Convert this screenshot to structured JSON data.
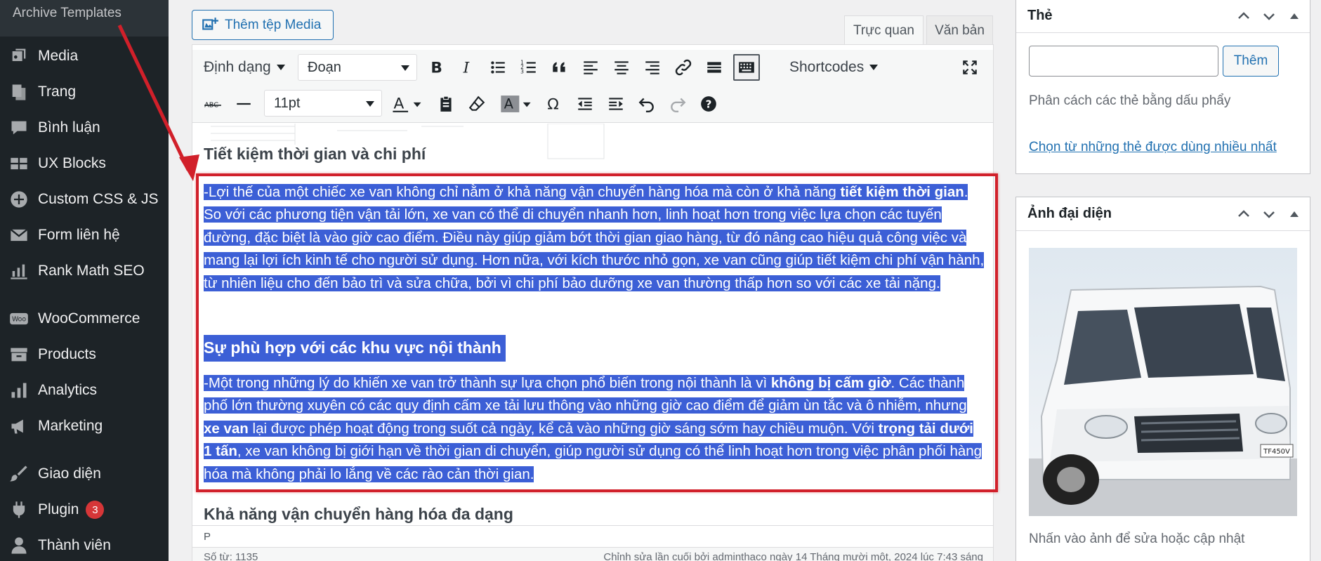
{
  "sidebar": {
    "top_item": "Archive Templates",
    "items": [
      {
        "label": "Media",
        "icon": "media-icon"
      },
      {
        "label": "Trang",
        "icon": "page-icon"
      },
      {
        "label": "Bình luận",
        "icon": "comment-icon"
      },
      {
        "label": "UX Blocks",
        "icon": "blocks-icon"
      },
      {
        "label": "Custom CSS & JS",
        "icon": "plus-circle-icon"
      },
      {
        "label": "Form liên hệ",
        "icon": "mail-icon"
      },
      {
        "label": "Rank Math SEO",
        "icon": "chart-icon"
      },
      {
        "label": "WooCommerce",
        "icon": "woo-icon"
      },
      {
        "label": "Products",
        "icon": "archive-icon"
      },
      {
        "label": "Analytics",
        "icon": "bar-chart-icon"
      },
      {
        "label": "Marketing",
        "icon": "megaphone-icon"
      },
      {
        "label": "Giao diện",
        "icon": "brush-icon"
      },
      {
        "label": "Plugin",
        "icon": "plugin-icon",
        "badge": "3"
      },
      {
        "label": "Thành viên",
        "icon": "user-icon"
      }
    ]
  },
  "editor": {
    "add_media_label": "Thêm tệp Media",
    "tab_visual": "Trực quan",
    "tab_text": "Văn bản",
    "toolbar": {
      "format_label": "Định dạng",
      "block_select": "Đoạn",
      "shortcodes_label": "Shortcodes",
      "font_size_select": "11pt"
    },
    "heading_1": "Tiết kiệm thời gian và chi phí",
    "para_1": {
      "part_a": "-Lợi thế của một chiếc xe van không chỉ nằm ở khả năng vận chuyển hàng hóa mà còn ở khả năng ",
      "bold_a": "tiết kiệm thời gian",
      "part_b": ". So với các phương tiện vận tải lớn, xe van có thể di chuyển nhanh hơn, linh hoạt hơn trong việc lựa chọn các tuyến đường, đặc biệt là vào giờ cao điểm. Điều này giúp giảm bớt thời gian giao hàng, từ đó nâng cao hiệu quả công việc và mang lại lợi ích kinh tế cho người sử dụng. Hơn nữa, với kích thước nhỏ gọn, xe van cũng giúp tiết kiệm chi phí vận hành, từ nhiên liệu cho đến bảo trì và sửa chữa, bởi vì chi phí bảo dưỡng xe van thường thấp hơn so với các xe tải nặng."
    },
    "heading_2": "Sự phù hợp với các khu vực nội thành",
    "para_2": {
      "part_a": "-Một trong những lý do khiến xe van trở thành sự lựa chọn phổ biến trong nội thành là vì ",
      "bold_a": "không bị cấm giờ",
      "part_b": ". Các thành phố lớn thường xuyên có các quy định cấm xe tải lưu thông vào những giờ cao điểm để giảm ùn tắc và ô nhiễm, nhưng ",
      "bold_b": "xe van",
      "part_c": " lại được phép hoạt động trong suốt cả ngày, kể cả vào những giờ sáng sớm hay chiều muộn. Với ",
      "bold_c": "trọng tải dưới 1 tấn",
      "part_d": ", xe van không bị giới hạn về thời gian di chuyển, giúp người sử dụng có thể linh hoạt hơn trong việc phân phối hàng hóa mà không phải lo lắng về các rào cản thời gian."
    },
    "heading_3": "Khả năng vận chuyển hàng hóa đa dạng",
    "path": "P",
    "word_count": "Số từ: 1135",
    "last_edited": "Chỉnh sửa lần cuối bởi adminthaco ngày 14 Tháng mười một, 2024 lúc 7:43 sáng"
  },
  "tags_panel": {
    "title": "Thẻ",
    "add_button": "Thêm",
    "input_value": "",
    "hint": "Phân cách các thẻ bằng dấu phẩy",
    "choose_link": "Chọn từ những thẻ được dùng nhiều nhất"
  },
  "featured_panel": {
    "title": "Ảnh đại diện",
    "caption": "Nhấn vào ảnh để sửa hoặc cập nhật",
    "van_plate": "TF450V"
  },
  "colors": {
    "sidebar_bg": "#1d2327",
    "selection": "#3c5fd6",
    "highlight_border": "#d1202a",
    "link": "#2271b1"
  }
}
